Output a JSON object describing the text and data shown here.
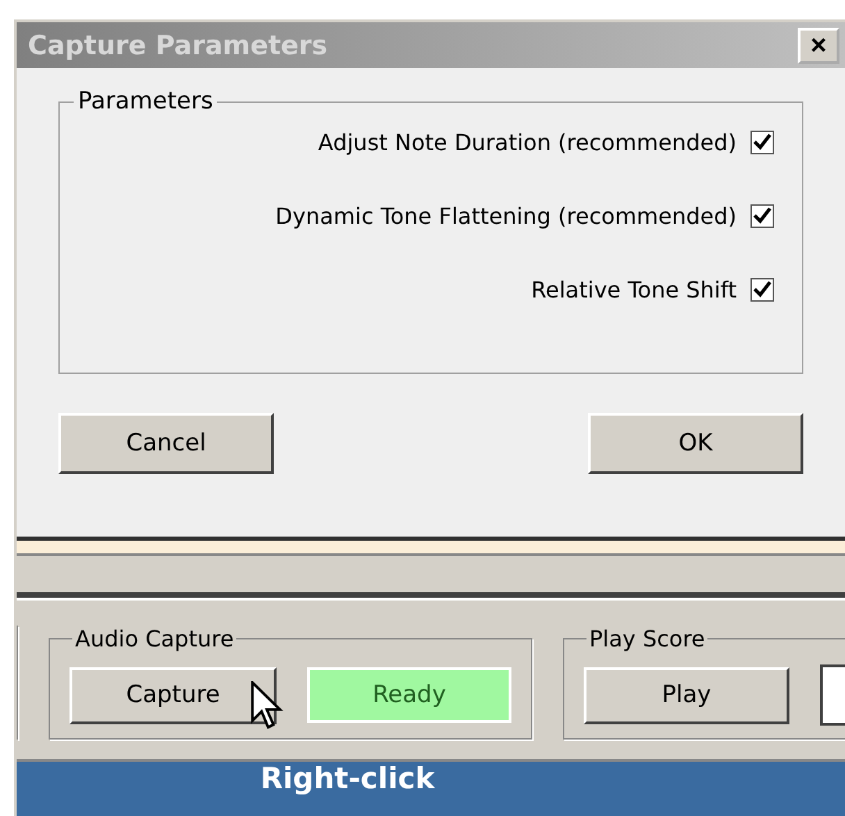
{
  "dialog": {
    "title": "Capture Parameters",
    "close_label": "×",
    "group_label": "Parameters",
    "options": [
      {
        "label": "Adjust Note Duration (recommended)",
        "checked": true
      },
      {
        "label": "Dynamic Tone Flattening (recommended)",
        "checked": true
      },
      {
        "label": "Relative Tone Shift",
        "checked": true
      }
    ],
    "buttons": [
      "Cancel",
      "OK"
    ]
  },
  "main": {
    "audio_capture": {
      "label": "Audio Capture",
      "button": "Capture",
      "status": "Ready"
    },
    "play_score": {
      "label": "Play Score",
      "button": "Play"
    }
  },
  "caption": "Right-click"
}
